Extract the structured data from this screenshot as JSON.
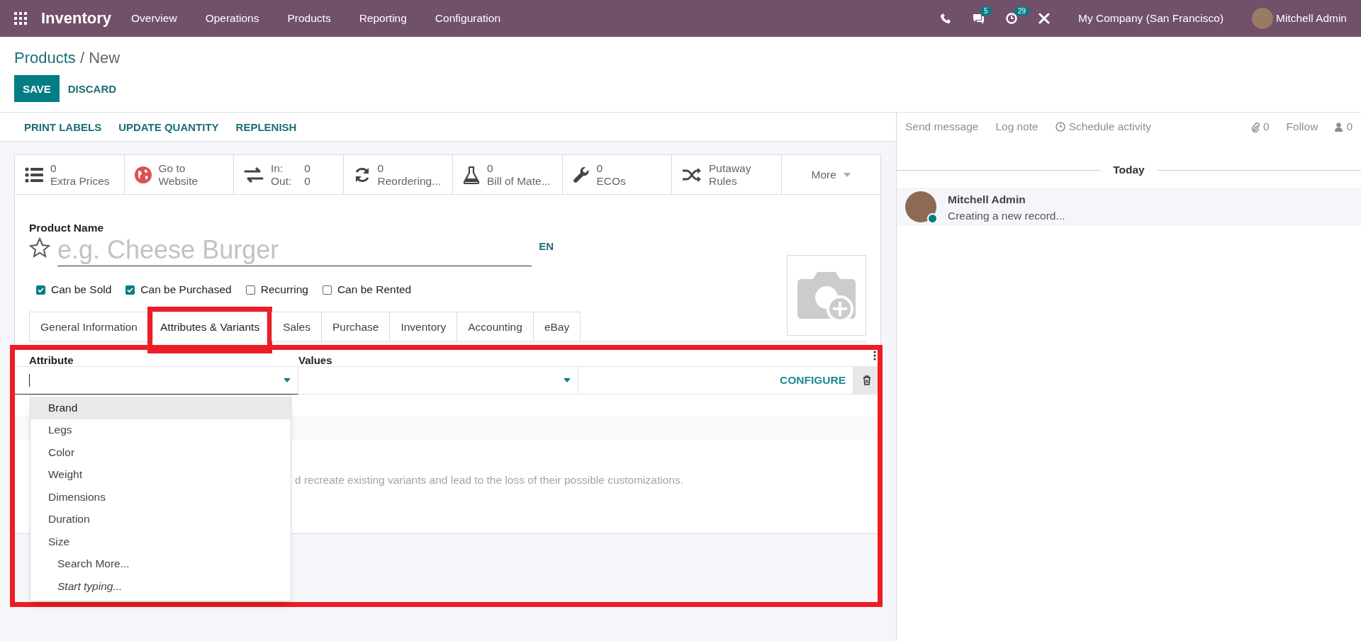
{
  "navbar": {
    "app_name": "Inventory",
    "menu": [
      "Overview",
      "Operations",
      "Products",
      "Reporting",
      "Configuration"
    ],
    "messages_count": "5",
    "activities_count": "29",
    "company": "My Company (San Francisco)",
    "user": "Mitchell Admin"
  },
  "breadcrumb": {
    "parent": "Products",
    "current": "/ New"
  },
  "buttons": [
    {
      "label": "SAVE",
      "kind": "primary"
    },
    {
      "label": "DISCARD",
      "kind": "link"
    }
  ],
  "actions": [
    "PRINT LABELS",
    "UPDATE QUANTITY",
    "REPLENISH"
  ],
  "smart_buttons": [
    {
      "kind": "stat",
      "value": "0",
      "label": "Extra Prices"
    },
    {
      "kind": "text",
      "lines": [
        "Go to",
        "Website"
      ]
    },
    {
      "kind": "inout",
      "in_label": "In:",
      "in_value": "0",
      "out_label": "Out:",
      "out_value": "0"
    },
    {
      "kind": "stat",
      "value": "0",
      "label": "Reordering..."
    },
    {
      "kind": "stat",
      "value": "0",
      "label": "Bill of Mate..."
    },
    {
      "kind": "stat",
      "value": "0",
      "label": "ECOs"
    },
    {
      "kind": "text",
      "lines": [
        "Putaway",
        "Rules"
      ]
    },
    {
      "kind": "more",
      "label": "More"
    }
  ],
  "product": {
    "label": "Product Name",
    "placeholder": "e.g. Cheese Burger",
    "starred": false,
    "language": "EN"
  },
  "checkboxes": [
    {
      "label": "Can be Sold",
      "checked": true
    },
    {
      "label": "Can be Purchased",
      "checked": true
    },
    {
      "label": "Recurring",
      "checked": false
    },
    {
      "label": "Can be Rented",
      "checked": false
    }
  ],
  "tabs": [
    {
      "label": "General Information",
      "selected": false,
      "highlighted": false
    },
    {
      "label": "Attributes & Variants",
      "selected": true,
      "highlighted": true
    },
    {
      "label": "Sales",
      "selected": false,
      "highlighted": false
    },
    {
      "label": "Purchase",
      "selected": false,
      "highlighted": false
    },
    {
      "label": "Inventory",
      "selected": false,
      "highlighted": false
    },
    {
      "label": "Accounting",
      "selected": false,
      "highlighted": false
    },
    {
      "label": "eBay",
      "selected": false,
      "highlighted": false
    }
  ],
  "attributes_table": {
    "highlighted": true,
    "columns": [
      "Attribute",
      "Values"
    ],
    "configure": "CONFIGURE",
    "warning": "d recreate existing variants and lead to the loss of their possible customizations."
  },
  "dropdown": {
    "items": [
      {
        "label": "Brand",
        "selected": true
      },
      {
        "label": "Legs",
        "selected": false
      },
      {
        "label": "Color",
        "selected": false
      },
      {
        "label": "Weight",
        "selected": false
      },
      {
        "label": "Dimensions",
        "selected": false
      },
      {
        "label": "Duration",
        "selected": false
      },
      {
        "label": "Size",
        "selected": false
      }
    ],
    "search_more": "Search More...",
    "start_typing": "Start typing..."
  },
  "chatter": {
    "send_message": "Send message",
    "log_note": "Log note",
    "schedule_activity": "Schedule activity",
    "attachments_count": "0",
    "follow": "Follow",
    "followers_count": "0",
    "date": "Today",
    "message": {
      "author": "Mitchell Admin",
      "body": "Creating a new record...",
      "online": true
    }
  }
}
